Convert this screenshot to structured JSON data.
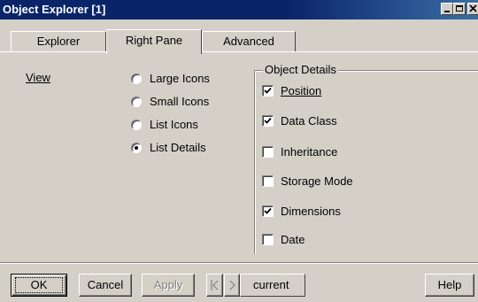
{
  "window": {
    "title": "Object Explorer [1]",
    "controls": [
      "minimize-icon",
      "maximize-icon",
      "close-icon"
    ]
  },
  "tabs": [
    {
      "label": "Explorer",
      "active": false
    },
    {
      "label": "Right Pane",
      "active": true
    },
    {
      "label": "Advanced",
      "active": false
    }
  ],
  "view": {
    "label": "View",
    "options": [
      {
        "label": "Large Icons",
        "selected": false
      },
      {
        "label": "Small Icons",
        "selected": false
      },
      {
        "label": "List Icons",
        "selected": false
      },
      {
        "label": "List Details",
        "selected": true
      }
    ]
  },
  "object_details": {
    "title": "Object Details",
    "items": [
      {
        "label": "Position",
        "checked": true
      },
      {
        "label": "Data Class",
        "checked": true
      },
      {
        "label": "Inheritance",
        "checked": false
      },
      {
        "label": "Storage Mode",
        "checked": false
      },
      {
        "label": "Dimensions",
        "checked": true
      },
      {
        "label": "Date",
        "checked": false
      }
    ]
  },
  "footer": {
    "ok_label": "OK",
    "cancel_label": "Cancel",
    "apply_label": "Apply",
    "nav_prev_icon": "prev-icon",
    "nav_next_icon": "next-icon",
    "current_label": "current",
    "help_label": "Help"
  }
}
